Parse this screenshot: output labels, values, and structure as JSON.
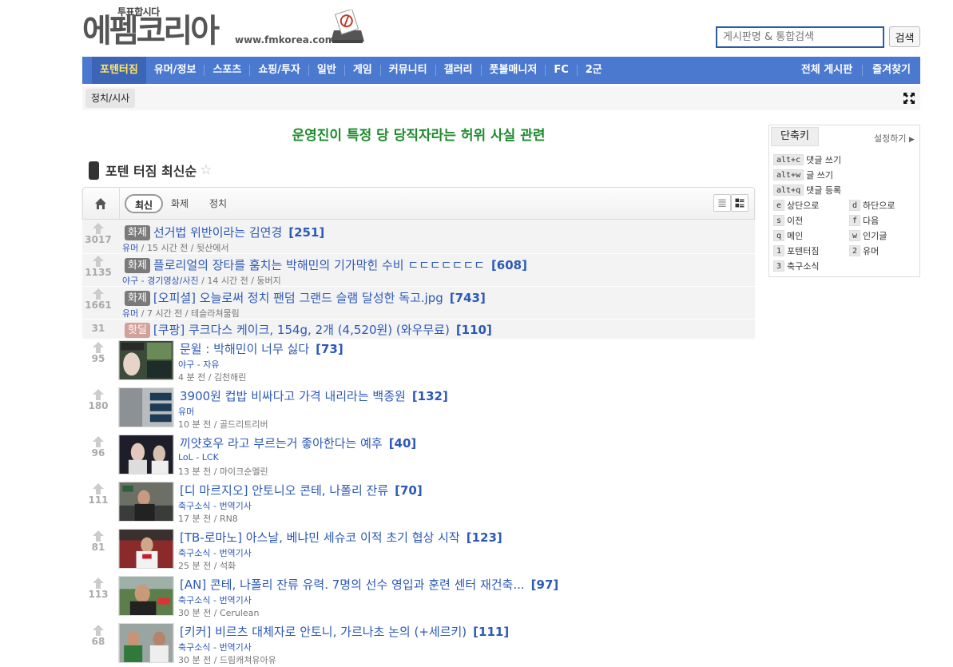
{
  "header": {
    "logo_top": "투표합시다",
    "logo_main": "에펨코리아",
    "logo_url": "www.fmkorea.com",
    "search_placeholder": "게시판명 & 통합검색",
    "search_button": "검색"
  },
  "nav": {
    "items": [
      "포텐터짐",
      "유머/정보",
      "스포츠",
      "쇼핑/투자",
      "일반",
      "게임",
      "커뮤니티",
      "갤러리",
      "풋볼매니저",
      "FC",
      "2군"
    ],
    "right": [
      "전체 게시판",
      "즐겨찾기"
    ]
  },
  "subnav": {
    "tab": "정치/시사"
  },
  "notice": "운영진이 특정 당 당직자라는 허위 사실 관련",
  "board": {
    "title": "포텐 터짐 최신순",
    "tabs": [
      "최신",
      "화제",
      "정치"
    ]
  },
  "posts": [
    {
      "votes": "3017",
      "badge": "화제",
      "title": "선거법 위반이라는 김연경",
      "comments": "[251]",
      "category": "유머",
      "time": "15 시간 전",
      "author": "뒷산에서"
    },
    {
      "votes": "1135",
      "badge": "화제",
      "title": "플로리얼의 장타를 훔치는 박해민의 기가막힌 수비 ㄷㄷㄷㄷㄷㄷㄷ",
      "comments": "[608]",
      "category": "야구 - 경기영상/사진",
      "time": "14 시간 전",
      "author": "둥버지"
    },
    {
      "votes": "1661",
      "badge": "화제",
      "title": "[오피셜] 오늘로써 정치 팬덤 그랜드 슬램 달성한 독고.jpg",
      "comments": "[743]",
      "category": "유머",
      "time": "7 시간 전",
      "author": "테슬라쳐물림"
    },
    {
      "votes": "31",
      "badge": "핫딜",
      "title": "[쿠팡] 쿠크다스 케이크, 154g, 2개 (4,520원) (와우무료)",
      "comments": "[110]"
    },
    {
      "votes": "95",
      "title": "문윌 : 박해민이 너무 싫다",
      "comments": "[73]",
      "category": "야구 - 자유",
      "time": "4 분 전",
      "author": "김천해린"
    },
    {
      "votes": "180",
      "title": "3900원 컵밥 비싸다고 가격 내리라는 백종원",
      "comments": "[132]",
      "category": "유머",
      "time": "10 분 전",
      "author": "골드리트리버"
    },
    {
      "votes": "96",
      "title": "끼얏호우 라고 부르는거 좋아한다는 예후",
      "comments": "[40]",
      "category": "LoL - LCK",
      "time": "13 분 전",
      "author": "마이크순멜린"
    },
    {
      "votes": "111",
      "title": "[디 마르지오] 안토니오 콘테, 나폴리 잔류",
      "comments": "[70]",
      "category": "축구소식 - 번역기사",
      "time": "17 분 전",
      "author": "RN8"
    },
    {
      "votes": "81",
      "title": "[TB-로마노] 아스날, 베냐민 세슈코 이적 초기 협상 시작",
      "comments": "[123]",
      "category": "축구소식 - 번역기사",
      "time": "25 분 전",
      "author": "석화"
    },
    {
      "votes": "113",
      "title": "[AN] 콘테, 나폴리 잔류 유력. 7명의 선수 영입과 훈련 센터 재건축...",
      "comments": "[97]",
      "category": "축구소식 - 번역기사",
      "time": "30 분 전",
      "author": "Cerulean"
    },
    {
      "votes": "68",
      "title": "[키커] 비르츠 대체자로 안토니, 가르나초 논의 (+세르키)",
      "comments": "[111]",
      "category": "축구소식 - 번역기사",
      "time": "30 분 전",
      "author": "드림캐쳐유아유"
    }
  ],
  "shortcuts": {
    "tab": "단축키",
    "setting": "설정하기",
    "items": [
      {
        "key": "alt+c",
        "label": "댓글 쓰기"
      },
      {
        "key": "alt+w",
        "label": "글 쓰기"
      },
      {
        "key": "alt+q",
        "label": "댓글 등록"
      },
      {
        "key": "e",
        "label": "상단으로"
      },
      {
        "key": "d",
        "label": "하단으로"
      },
      {
        "key": "s",
        "label": "이전"
      },
      {
        "key": "f",
        "label": "다음"
      },
      {
        "key": "q",
        "label": "메인"
      },
      {
        "key": "w",
        "label": "인기글"
      },
      {
        "key": "1",
        "label": "포텐터짐"
      },
      {
        "key": "2",
        "label": "유머"
      },
      {
        "key": "3",
        "label": "축구소식"
      }
    ]
  },
  "colors": {
    "nav": "#4b79cf",
    "link": "#2b59b8",
    "notice": "#1d8a2c"
  }
}
